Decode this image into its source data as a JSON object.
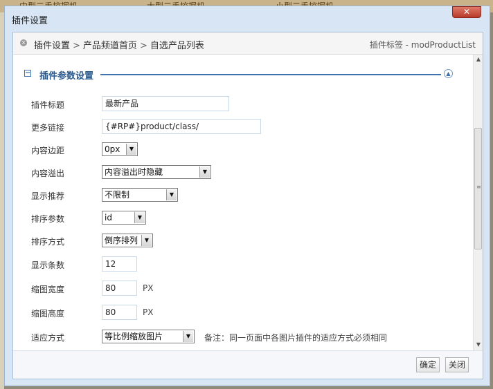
{
  "background": {
    "left_text": "中型二手挖掘机",
    "mid_text": "大型二手挖掘机",
    "right_text": "小型二手挖掘机"
  },
  "dialog": {
    "title": "插件设置",
    "close_label": "✕"
  },
  "breadcrumb": {
    "items": [
      "插件设置",
      "产品频道首页",
      "自选产品列表"
    ],
    "right": "插件标签 - modProductList"
  },
  "section": {
    "title": "插件参数设置"
  },
  "form": {
    "plugin_title": {
      "label": "插件标题",
      "value": "最新产品"
    },
    "more_link": {
      "label": "更多链接",
      "value": "{#RP#}product/class/"
    },
    "content_margin": {
      "label": "内容边距",
      "value": "0px"
    },
    "content_overflow": {
      "label": "内容溢出",
      "value": "内容溢出时隐藏"
    },
    "show_recommend": {
      "label": "显示推荐",
      "value": "不限制"
    },
    "sort_param": {
      "label": "排序参数",
      "value": "id"
    },
    "sort_order": {
      "label": "排序方式",
      "value": "倒序排列"
    },
    "display_count": {
      "label": "显示条数",
      "value": "12"
    },
    "thumb_width": {
      "label": "缩图宽度",
      "value": "80",
      "unit": "PX"
    },
    "thumb_height": {
      "label": "缩图高度",
      "value": "80",
      "unit": "PX"
    },
    "fit_mode": {
      "label": "适应方式",
      "value": "等比例缩放图片",
      "note": "备注：同一页面中各图片插件的适应方式必须相同"
    }
  },
  "footer": {
    "confirm": "确定",
    "close": "关闭"
  },
  "colors": {
    "accent": "#2b5a8e",
    "dialog_bg": "#d7e5f4",
    "close_red": "#c0493a"
  },
  "icons": {
    "collapse": "minus-square-icon",
    "scroll_top": "up-circle-icon",
    "breadcrumb": "circle-x-icon"
  }
}
